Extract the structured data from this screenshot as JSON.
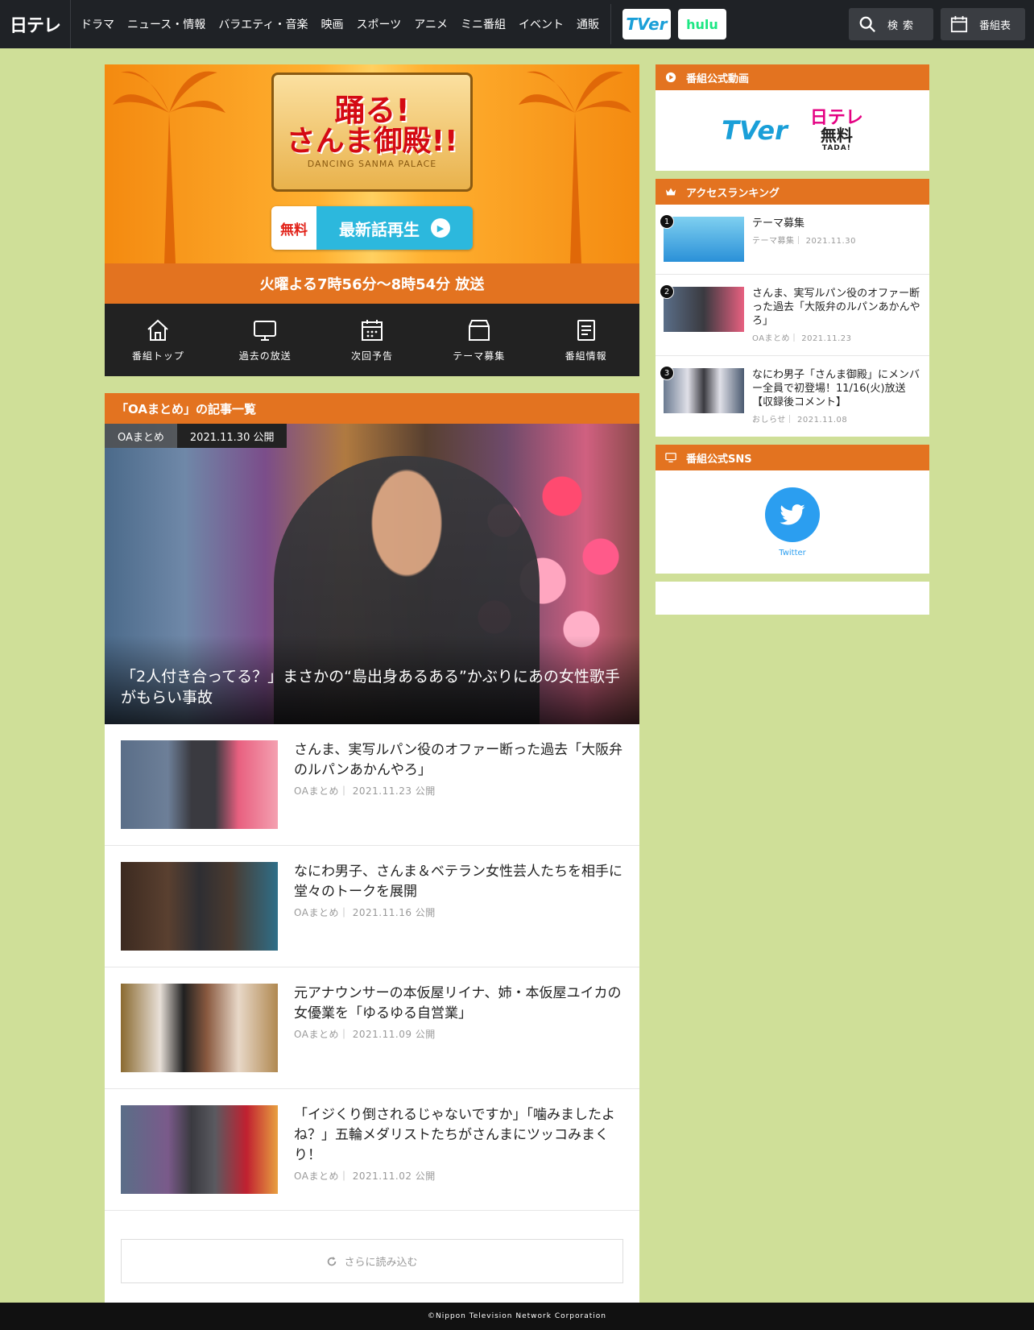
{
  "header": {
    "logo": "日テレ",
    "nav": [
      "ドラマ",
      "ニュース・情報",
      "バラエティ・音楽",
      "映画",
      "スポーツ",
      "アニメ",
      "ミニ番組",
      "イベント",
      "通販"
    ],
    "services": {
      "tver": "TVer",
      "hulu": "hulu"
    },
    "search_label": "検索",
    "schedule_label": "番組表"
  },
  "hero": {
    "logo_line1": "踊る!",
    "logo_line2": "さんま御殿!!",
    "logo_sub": "DANCING SANMA PALACE",
    "free_label": "無料",
    "play_label": "最新話再生",
    "airtime": "火曜よる7時56分～8時54分 放送"
  },
  "program_nav": [
    {
      "label": "番組トップ",
      "icon": "home-icon"
    },
    {
      "label": "過去の放送",
      "icon": "monitor-icon"
    },
    {
      "label": "次回予告",
      "icon": "calendar-icon"
    },
    {
      "label": "テーマ募集",
      "icon": "box-icon"
    },
    {
      "label": "番組情報",
      "icon": "document-icon"
    }
  ],
  "article_section": {
    "title": "「OAまとめ」の記事一覧",
    "feature": {
      "category": "OAまとめ",
      "date": "2021.11.30 公開",
      "title": "「2人付き合ってる？」まさかの“島出身あるある”かぶりにあの女性歌手がもらい事故"
    },
    "items": [
      {
        "title": "さんま、実写ルパン役のオファー断った過去「大阪弁のルパンあかんやろ」",
        "meta": "OAまとめ｜ 2021.11.23 公開"
      },
      {
        "title": "なにわ男子、さんま＆ベテラン女性芸人たちを相手に堂々のトークを展開",
        "meta": "OAまとめ｜ 2021.11.16 公開"
      },
      {
        "title": "元アナウンサーの本仮屋リイナ、姉・本仮屋ユイカの女優業を「ゆるゆる自営業」",
        "meta": "OAまとめ｜ 2021.11.09 公開"
      },
      {
        "title": "「イジくり倒されるじゃないですか」「噛みましたよね？」五輪メダリストたちがさんまにツッコみまくり！",
        "meta": "OAまとめ｜ 2021.11.02 公開"
      }
    ],
    "load_more": "さらに読み込む"
  },
  "sidebar": {
    "video": {
      "title": "番組公式動画",
      "tver": "TVer",
      "ntv_free_1": "日テレ",
      "ntv_free_2": "無料",
      "ntv_free_3": "TADA!"
    },
    "ranking": {
      "title": "アクセスランキング",
      "items": [
        {
          "rank": "1",
          "title": "テーマ募集",
          "meta": "テーマ募集｜ 2021.11.30"
        },
        {
          "rank": "2",
          "title": "さんま、実写ルパン役のオファー断った過去「大阪弁のルパンあかんやろ」",
          "meta": "OAまとめ｜ 2021.11.23"
        },
        {
          "rank": "3",
          "title": "なにわ男子「さんま御殿」にメンバー全員で初登場！11/16(火)放送【収録後コメント】",
          "meta": "おしらせ｜ 2021.11.08"
        }
      ]
    },
    "sns": {
      "title": "番組公式SNS",
      "twitter_label": "Twitter"
    }
  },
  "footer": {
    "copyright": "©Nippon Television Network Corporation"
  }
}
